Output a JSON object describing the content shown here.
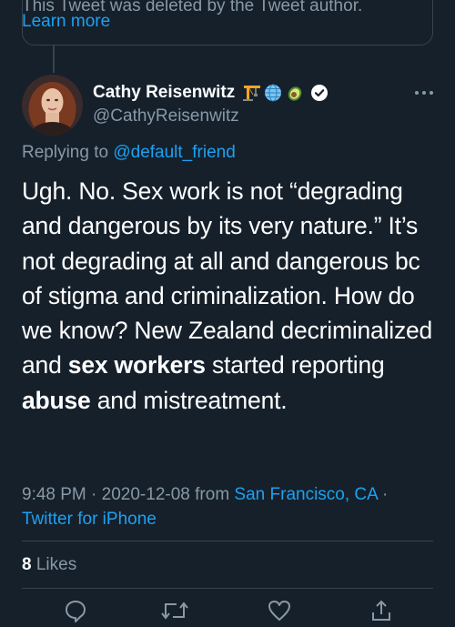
{
  "quoted": {
    "deleted_text": "This Tweet was deleted by the Tweet author.",
    "learn_more": "Learn more"
  },
  "tweet": {
    "author_name": "Cathy Reisenwitz",
    "author_handle": "@CathyReisenwitz",
    "badges": [
      "construction-crane-icon",
      "globe-icon",
      "avocado-icon",
      "verified-badge-icon"
    ],
    "replying_prefix": "Replying to",
    "replying_to": "@default_friend",
    "text_part1": "Ugh. No. Sex work is not “degrading and dangerous by its very nature.” It’s not degrading at all and dangerous bc of stigma and criminalization. How do we know? New Zealand decriminalized and ",
    "bold1": "sex workers",
    "text_part2": " started reporting ",
    "bold2": "abuse",
    "text_part3": " and mistreatment.",
    "time": "9:48 PM",
    "date": "2020-12-08",
    "from_label": "from",
    "location": "San Francisco, CA",
    "separator": "·",
    "client": "Twitter for iPhone",
    "likes_count": "8",
    "likes_label": "Likes"
  },
  "actions": [
    "reply-icon",
    "retweet-icon",
    "like-icon",
    "share-icon"
  ],
  "colors": {
    "background": "#15202b",
    "text": "#ffffff",
    "secondary": "#8899a6",
    "accent": "#1da1f2",
    "border": "#38444d"
  }
}
